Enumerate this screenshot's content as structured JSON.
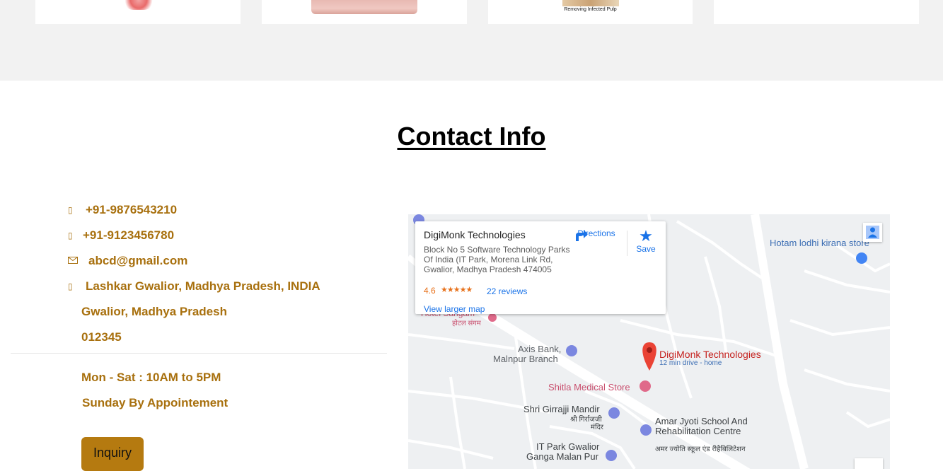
{
  "services": {
    "card3_caption": "Removing Infected Pulp"
  },
  "contact": {
    "title": "Contact Info",
    "phone1": "+91-9876543210",
    "phone2": "+91-9123456780",
    "email": "abcd@gmail.com",
    "address_line1": "Lashkar Gwalior, Madhya Pradesh, INDIA",
    "address_line2": "Gwalior, Madhya Pradesh",
    "address_line3": "012345",
    "hours_weekday": "Mon - Sat : 10AM to 5PM",
    "hours_sunday": "Sunday By Appointement",
    "inquiry_label": "Inquiry",
    "icons": [
      "phone-icon",
      "phone-icon",
      "envelope-icon",
      "map-marker-icon"
    ],
    "accent_color": "#a8700e",
    "button_color": "#b57a10"
  },
  "map": {
    "place_name": "DigiMonk Technologies",
    "address": "Block No 5 Software Technology Parks Of India (IT Park, Morena Link Rd, Gwalior, Madhya Pradesh 474005",
    "rating": "4.6",
    "stars": "★★★★★",
    "reviews": "22 reviews",
    "directions_label": "Directions",
    "save_label": "Save",
    "view_larger": "View larger map",
    "labels": {
      "hotam": "Hotam lodhi kirana store",
      "hotel_sangam": "Hotel Sangam",
      "hotel_sangam_hi": "होटल संगम",
      "axis_bank_1": "Axis Bank,",
      "axis_bank_2": "Malnpur Branch",
      "marker_name": "DigiMonk Technologies",
      "marker_sub": "12 min drive - home",
      "shitla": "Shitla Medical Store",
      "girraj_1": "Shri Girrajji Mandir",
      "girraj_hi_1": "श्री गिर्राजजी",
      "girraj_hi_2": "मंदिर",
      "amar_1": "Amar Jyoti School And",
      "amar_2": "Rehabilitation Centre",
      "amar_hi": "अमर ज्योति स्कूल एंड रीहैबिलिटेशन",
      "itpark_1": "IT Park Gwalior",
      "itpark_2": "Ganga Malan Pur"
    },
    "colors": {
      "link": "#1a73e8",
      "rating": "#e7711b",
      "marker": "#ea4335",
      "poi_pink": "#e06a8a",
      "road": "#ffffff",
      "land": "#eef0f2"
    }
  }
}
